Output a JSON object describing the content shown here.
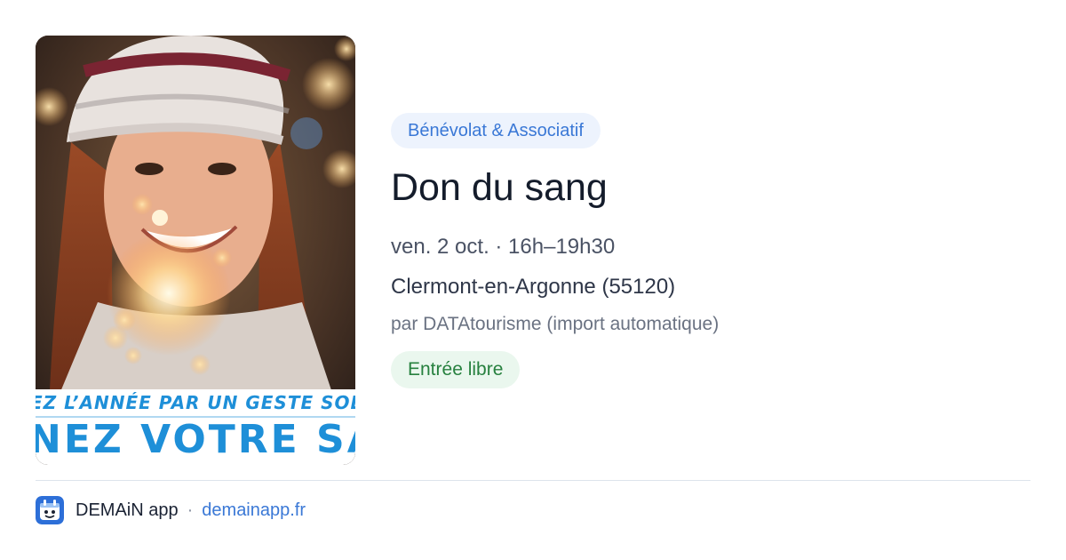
{
  "event": {
    "category": "Bénévolat & Associatif",
    "title": "Don du sang",
    "datetime": "ven. 2 oct. · 16h–19h30",
    "location": "Clermont-en-Argonne (55120)",
    "organizer": "par DATAtourisme (import automatique)",
    "price": "Entrée libre"
  },
  "image": {
    "banner_line1": "EZ L’ANNÉE PAR UN GESTE SOLI",
    "banner_line2": "NEZ VOTRE SAN"
  },
  "footer": {
    "app_name": "DEMAiN app",
    "separator": "·",
    "site": "demainapp.fr"
  },
  "colors": {
    "badge_blue": "#3a78d6",
    "badge_green": "#27813f",
    "banner_blue": "#1e8fd8"
  }
}
